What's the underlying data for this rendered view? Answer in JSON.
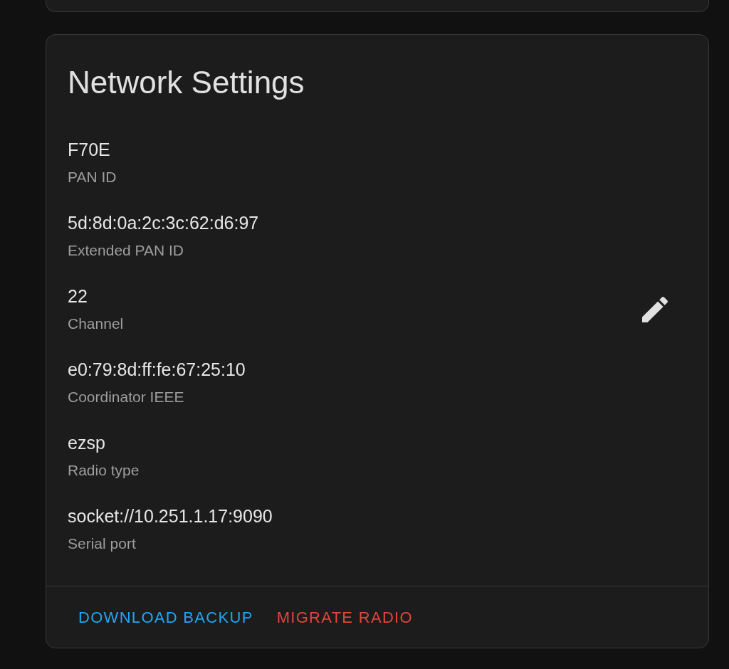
{
  "card": {
    "title": "Network Settings",
    "fields": [
      {
        "value": "F70E",
        "label": "PAN ID",
        "editable": false
      },
      {
        "value": "5d:8d:0a:2c:3c:62:d6:97",
        "label": "Extended PAN ID",
        "editable": false
      },
      {
        "value": "22",
        "label": "Channel",
        "editable": true
      },
      {
        "value": "e0:79:8d:ff:fe:67:25:10",
        "label": "Coordinator IEEE",
        "editable": false
      },
      {
        "value": "ezsp",
        "label": "Radio type",
        "editable": false
      },
      {
        "value": "socket://10.251.1.17:9090",
        "label": "Serial port",
        "editable": false
      }
    ],
    "actions": [
      {
        "label": "DOWNLOAD BACKUP",
        "kind": "primary"
      },
      {
        "label": "MIGRATE RADIO",
        "kind": "danger"
      }
    ]
  }
}
